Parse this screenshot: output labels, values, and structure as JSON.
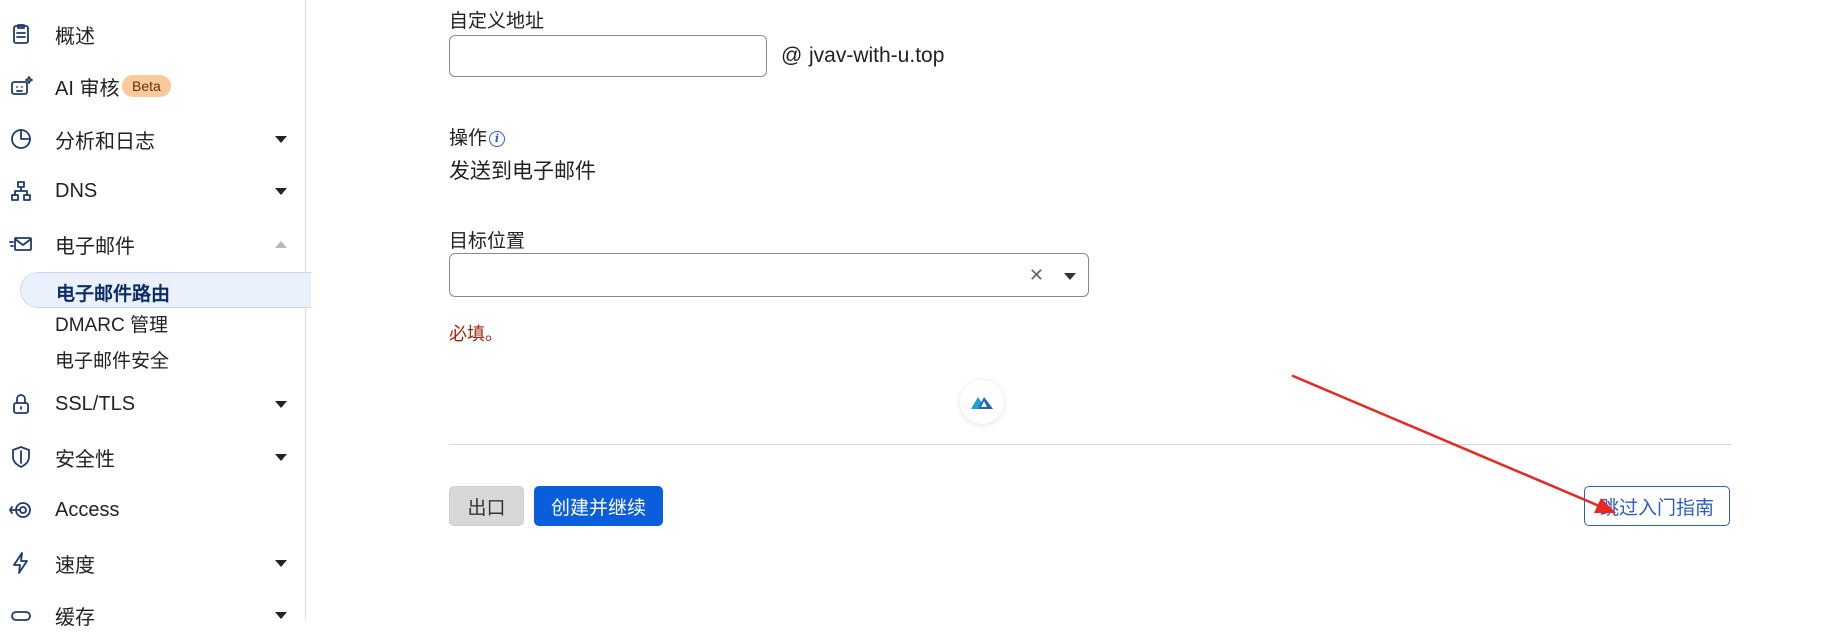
{
  "sidebar": {
    "items": [
      {
        "label": "概述",
        "icon": "clipboard-icon"
      },
      {
        "label": "AI 审核",
        "icon": "robot-icon",
        "badge": "Beta"
      },
      {
        "label": "分析和日志",
        "icon": "pie-chart-icon"
      },
      {
        "label": "DNS",
        "icon": "network-icon"
      },
      {
        "label": "电子邮件",
        "icon": "email-icon"
      },
      {
        "label": "SSL/TLS",
        "icon": "lock-icon"
      },
      {
        "label": "安全性",
        "icon": "shield-icon"
      },
      {
        "label": "Access",
        "icon": "access-icon"
      },
      {
        "label": "速度",
        "icon": "lightning-icon"
      },
      {
        "label": "缓存",
        "icon": "cache-icon"
      }
    ],
    "email_subitems": [
      "电子邮件路由",
      "DMARC 管理",
      "电子邮件安全"
    ]
  },
  "form": {
    "custom_address_label": "自定义地址",
    "custom_address_value": "",
    "at_symbol": "@",
    "domain": "jvav-with-u.top",
    "action_label": "操作",
    "action_value": "发送到电子邮件",
    "destination_label": "目标位置",
    "destination_value": "",
    "error_text": "必填。"
  },
  "buttons": {
    "exit": "出口",
    "create_continue": "创建并继续",
    "skip_guide": "跳过入门指南"
  },
  "colors": {
    "primary": "#0a5ddb",
    "link": "#2c5cc4",
    "error": "#a3250c",
    "annotation_arrow": "#e8281f"
  }
}
